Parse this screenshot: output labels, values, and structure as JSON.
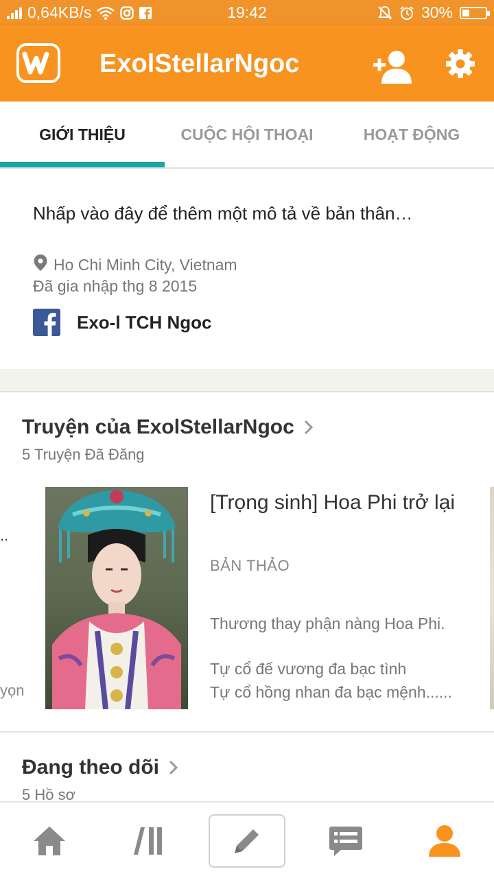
{
  "status_bar": {
    "network_speed": "0,64KB/s",
    "time": "19:42",
    "battery_percent": "30%",
    "battery_level": 0.3
  },
  "app_bar": {
    "title": "ExolStellarNgoc",
    "logo_glyph": "w",
    "icons": [
      "add-friend-icon",
      "settings-icon"
    ],
    "accent_color": "#f7931e"
  },
  "tabs": [
    {
      "label": "GIỚI THIỆU",
      "active": true
    },
    {
      "label": "CUỘC HỘI THOẠI",
      "active": false
    },
    {
      "label": "HOẠT ĐỘNG",
      "active": false
    }
  ],
  "about": {
    "description_placeholder": "Nhấp vào đây để thêm một mô tả về bản thân…",
    "location": "Ho Chi Minh City, Vietnam",
    "joined": "Đã gia nhập thg 8 2015",
    "facebook_name": "Exo-l TCH Ngoc"
  },
  "stories_section": {
    "title": "Truyện của ExolStellarNgoc",
    "subtitle": "5 Truyện Đã Đăng",
    "prev_peek_dots": "..",
    "prev_peek_text": "yọn",
    "story": {
      "title": "[Trọng sinh] Hoa Phi trở lại",
      "status": "BẢN THẢO",
      "description": [
        "Thương thay phận nàng Hoa Phi.",
        "",
        "Tự cổ đế vương đa bạc tình",
        "Tự cổ hồng nhan đa bạc mệnh......"
      ]
    }
  },
  "following_section": {
    "title": "Đang theo dõi",
    "subtitle": "5 Hồ sơ"
  },
  "bottom_nav": [
    {
      "name": "home-icon",
      "active": false
    },
    {
      "name": "library-icon",
      "active": false
    },
    {
      "name": "write-icon",
      "active": false
    },
    {
      "name": "messages-icon",
      "active": false
    },
    {
      "name": "profile-icon",
      "active": true
    }
  ],
  "colors": {
    "brand_orange": "#f7931e",
    "tab_indicator": "#17a6a6",
    "facebook_blue": "#3b5998",
    "nav_inactive": "#8a8a8a"
  }
}
